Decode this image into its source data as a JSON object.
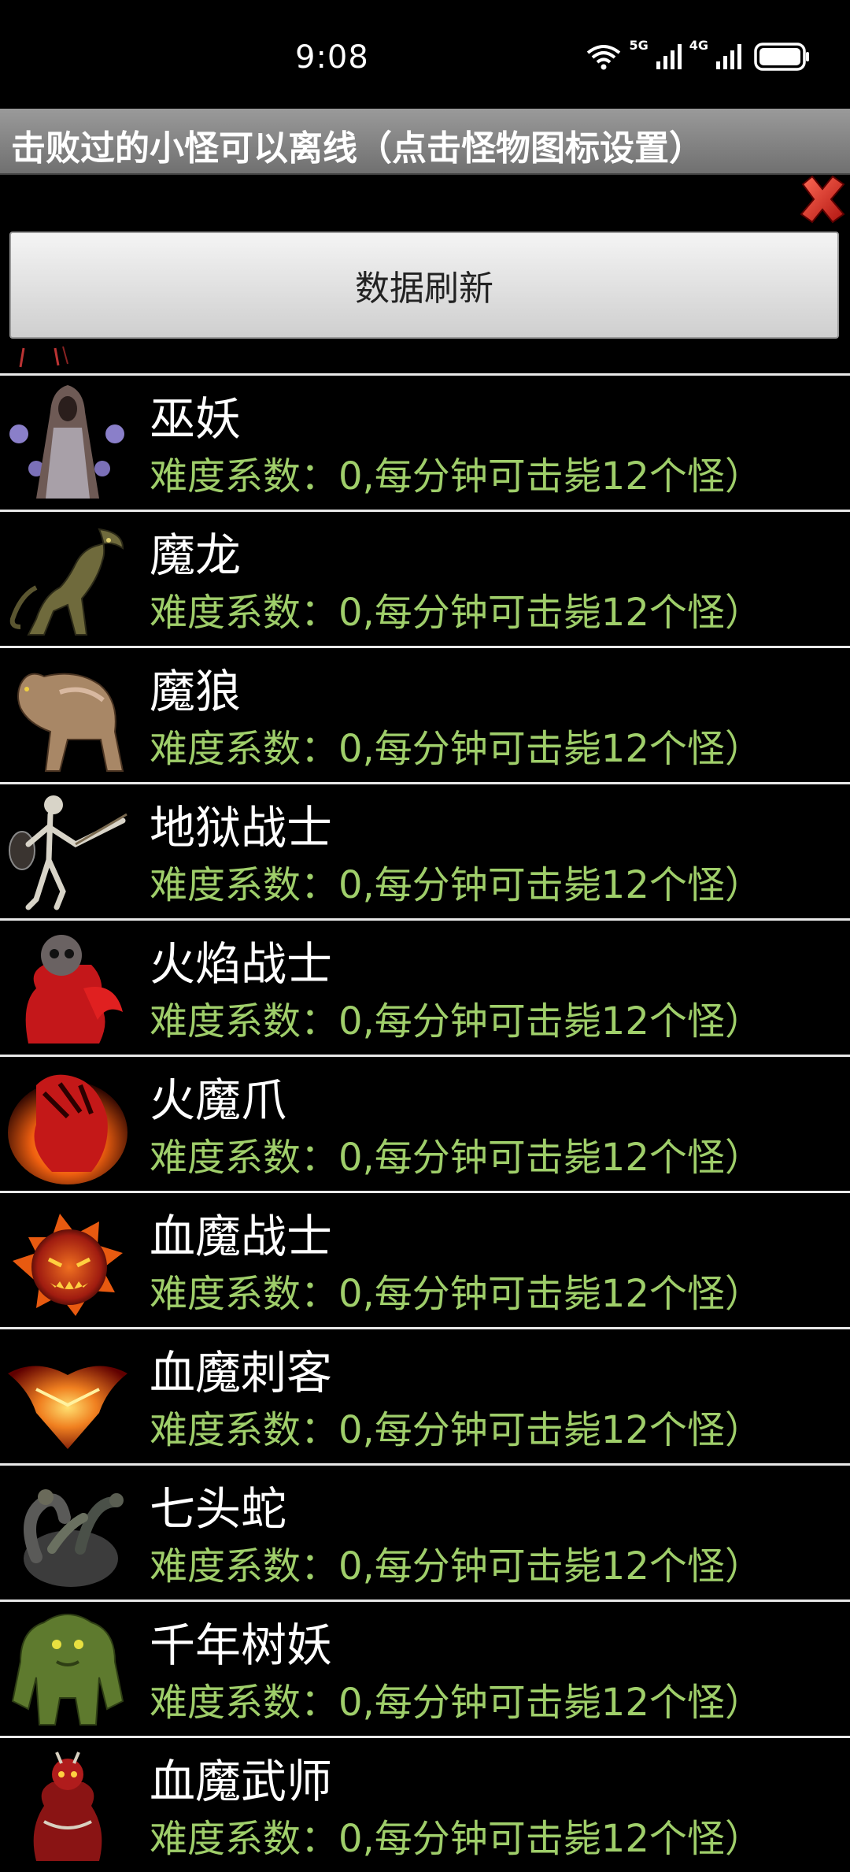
{
  "status_bar": {
    "time": "9:08",
    "network_1": "5G",
    "network_2": "4G",
    "icons": [
      "wifi-icon",
      "signal-5g-icon",
      "signal-4g-icon",
      "battery-icon"
    ]
  },
  "header": {
    "title": "击败过的小怪可以离线（点击怪物图标设置）"
  },
  "actions": {
    "refresh_label": "数据刷新",
    "close_icon": "close-x-icon"
  },
  "colors": {
    "background": "#000000",
    "description_green": "#9fce6a",
    "close_red": "#d4221c",
    "divider": "#e8e8e8"
  },
  "monsters": [
    {
      "name": "巫妖",
      "description": "难度系数：0,每分钟可击毙12个怪）",
      "icon": "lich-icon"
    },
    {
      "name": "魔龙",
      "description": "难度系数：0,每分钟可击毙12个怪）",
      "icon": "demon-dragon-icon"
    },
    {
      "name": "魔狼",
      "description": "难度系数：0,每分钟可击毙12个怪）",
      "icon": "demon-wolf-icon"
    },
    {
      "name": "地狱战士",
      "description": "难度系数：0,每分钟可击毙12个怪）",
      "icon": "hell-warrior-icon"
    },
    {
      "name": "火焰战士",
      "description": "难度系数：0,每分钟可击毙12个怪）",
      "icon": "flame-warrior-icon"
    },
    {
      "name": "火魔爪",
      "description": "难度系数：0,每分钟可击毙12个怪）",
      "icon": "fire-claw-icon"
    },
    {
      "name": "血魔战士",
      "description": "难度系数：0,每分钟可击毙12个怪）",
      "icon": "blood-warrior-icon"
    },
    {
      "name": "血魔刺客",
      "description": "难度系数：0,每分钟可击毙12个怪）",
      "icon": "blood-assassin-icon"
    },
    {
      "name": "七头蛇",
      "description": "难度系数：0,每分钟可击毙12个怪）",
      "icon": "hydra-icon"
    },
    {
      "name": "千年树妖",
      "description": "难度系数：0,每分钟可击毙12个怪）",
      "icon": "tree-demon-icon"
    },
    {
      "name": "血魔武师",
      "description": "难度系数：0,每分钟可击毙12个怪）",
      "icon": "blood-martial-icon"
    }
  ]
}
